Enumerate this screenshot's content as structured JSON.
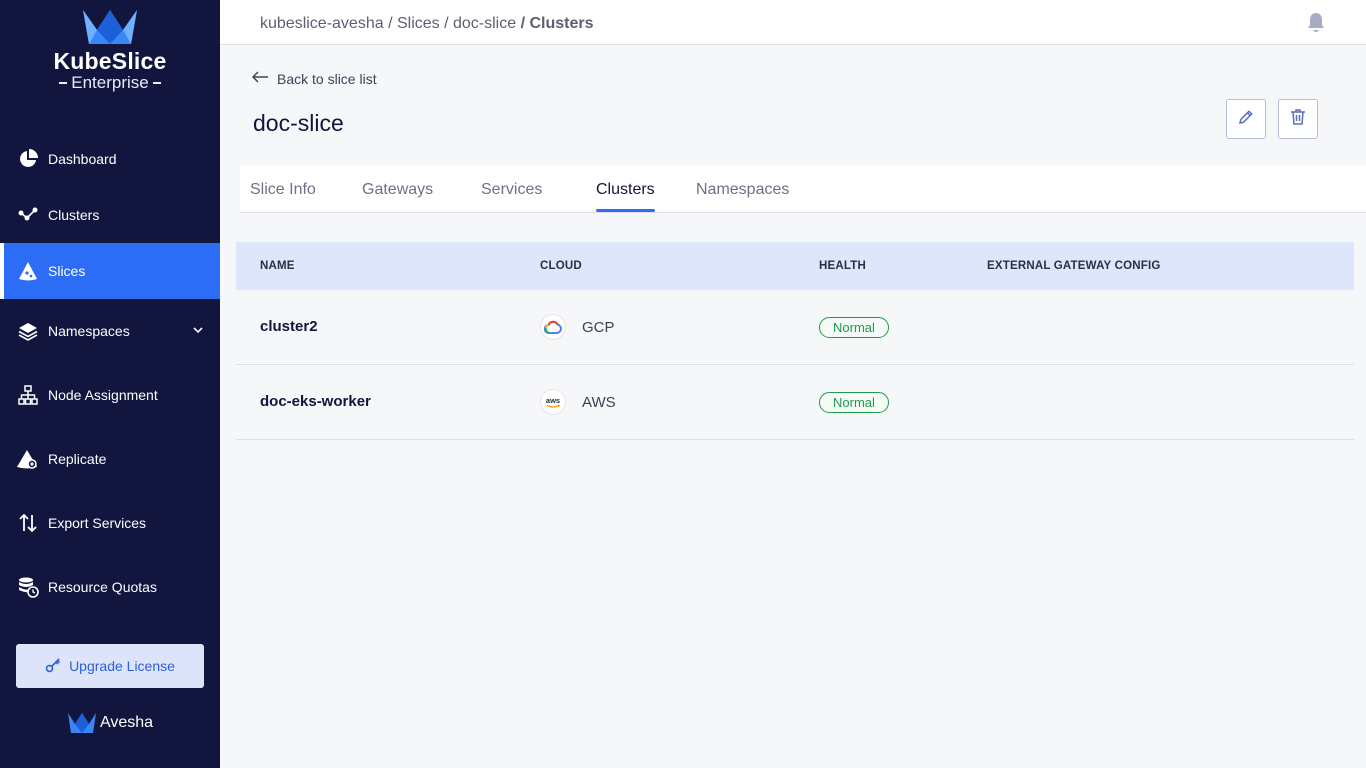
{
  "brand": {
    "title": "KubeSlice",
    "subtitle": "Enterprise",
    "footer": "Avesha"
  },
  "sidebar": {
    "items": [
      {
        "label": "Dashboard",
        "icon": "pie-chart-icon"
      },
      {
        "label": "Clusters",
        "icon": "nodes-icon"
      },
      {
        "label": "Slices",
        "icon": "slice-icon",
        "active": true
      },
      {
        "label": "Namespaces",
        "icon": "layers-icon",
        "expandable": true
      },
      {
        "label": "Node Assignment",
        "icon": "hierarchy-icon"
      },
      {
        "label": "Replicate",
        "icon": "replicate-icon"
      },
      {
        "label": "Export Services",
        "icon": "arrows-updown-icon"
      },
      {
        "label": "Resource Quotas",
        "icon": "database-clock-icon"
      }
    ],
    "upgrade_label": "Upgrade License"
  },
  "header": {
    "breadcrumb": [
      "kubeslice-avesha",
      "Slices",
      "doc-slice"
    ],
    "breadcrumb_current": "Clusters"
  },
  "main": {
    "back_label": "Back to slice list",
    "title": "doc-slice",
    "tabs": [
      {
        "label": "Slice Info"
      },
      {
        "label": "Gateways"
      },
      {
        "label": "Services"
      },
      {
        "label": "Clusters",
        "active": true
      },
      {
        "label": "Namespaces"
      }
    ],
    "table": {
      "columns": [
        "NAME",
        "CLOUD",
        "HEALTH",
        "EXTERNAL GATEWAY CONFIG"
      ],
      "rows": [
        {
          "name": "cluster2",
          "cloud": "GCP",
          "cloud_icon": "gcp-icon",
          "health": "Normal",
          "gateway": ""
        },
        {
          "name": "doc-eks-worker",
          "cloud": "AWS",
          "cloud_icon": "aws-icon",
          "health": "Normal",
          "gateway": ""
        }
      ]
    }
  },
  "colors": {
    "sidebar_bg": "#12153e",
    "accent": "#2d6cf5",
    "status_ok": "#1f9a4a",
    "table_header_bg": "#dde6fb"
  }
}
